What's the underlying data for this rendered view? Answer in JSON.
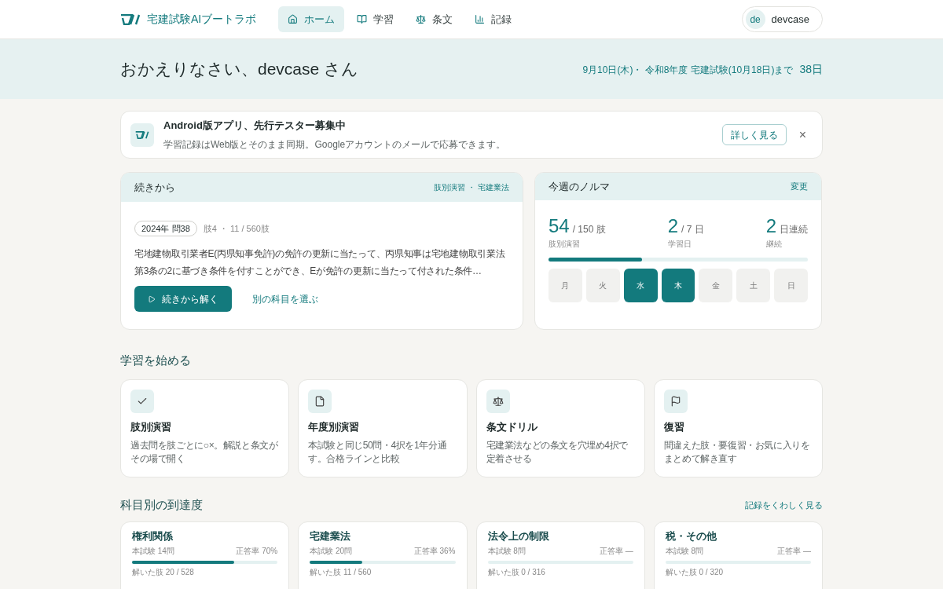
{
  "header": {
    "brand": "宅建試験AIブートラボ",
    "nav": [
      {
        "label": "ホーム",
        "selected": true
      },
      {
        "label": "学習",
        "selected": false
      },
      {
        "label": "条文",
        "selected": false
      },
      {
        "label": "記録",
        "selected": false
      }
    ],
    "user": {
      "initials": "de",
      "name": "devcase"
    }
  },
  "welcome": {
    "greeting": "おかえりなさい、devcase さん",
    "date": "9月10日(木)・ 令和8年度 宅建試験(10月18日)まで",
    "days_left": "38日"
  },
  "banner": {
    "title": "Android版アプリ、先行テスター募集中",
    "text": "学習記録はWeb版とそのまま同期。Googleアカウントのメールで応募できます。",
    "button": "詳しく見る",
    "close": "×"
  },
  "continue": {
    "title": "続きから",
    "tag": "肢別演習 ・ 宅建業法",
    "question_badge": "2024年 問38",
    "progress": "肢4 ・ 11 / 560肢",
    "question": "宅地建物取引業者E(丙県知事免許)の免許の更新に当たって、丙県知事は宅地建物取引業法第3条の2に基づき条件を付すことができ、Eが免許の更新に当たって付された条件…",
    "primary": "続きから解く",
    "secondary": "別の科目を選ぶ"
  },
  "quota": {
    "title": "今週のノルマ",
    "action": "変更",
    "stats": [
      {
        "value": "54",
        "unit": "/ 150 肢",
        "label": "肢別演習"
      },
      {
        "value": "2",
        "unit": "/ 7 日",
        "label": "学習日"
      },
      {
        "value": "2",
        "unit": "日連続",
        "label": "継続"
      }
    ],
    "level": 0.36,
    "days": [
      {
        "label": "月",
        "done": false
      },
      {
        "label": "火",
        "done": false
      },
      {
        "label": "水",
        "done": true
      },
      {
        "label": "木",
        "done": true
      },
      {
        "label": "金",
        "done": false
      },
      {
        "label": "土",
        "done": false
      },
      {
        "label": "日",
        "done": false
      }
    ]
  },
  "start": {
    "title": "学習を始める",
    "cards": [
      {
        "title": "肢別演習",
        "text": "過去問を肢ごとに○×。解説と条文がその場で開く"
      },
      {
        "title": "年度別演習",
        "text": "本試験と同じ50問・4択を1年分通す。合格ラインと比較"
      },
      {
        "title": "条文ドリル",
        "text": "宅建業法などの条文を穴埋め4択で定着させる"
      },
      {
        "title": "復習",
        "text": "間違えた肢・要復習・お気に入りをまとめて解き直す"
      }
    ]
  },
  "subjects": {
    "title": "科目別の到達度",
    "link": "記録をくわしく見る",
    "items": [
      {
        "name": "権利関係",
        "exam": "本試験 14問",
        "rate": "正答率 70%",
        "level": 0.7,
        "solved": "解いた肢 20 / 528"
      },
      {
        "name": "宅建業法",
        "exam": "本試験 20問",
        "rate": "正答率 36%",
        "level": 0.36,
        "solved": "解いた肢 11 / 560"
      },
      {
        "name": "法令上の制限",
        "exam": "本試験 8問",
        "rate": "正答率 —",
        "solved": "解いた肢 0 / 316"
      },
      {
        "name": "税・その他",
        "exam": "本試験 8問",
        "rate": "正答率 —",
        "solved": "解いた肢 0 / 320"
      }
    ]
  }
}
